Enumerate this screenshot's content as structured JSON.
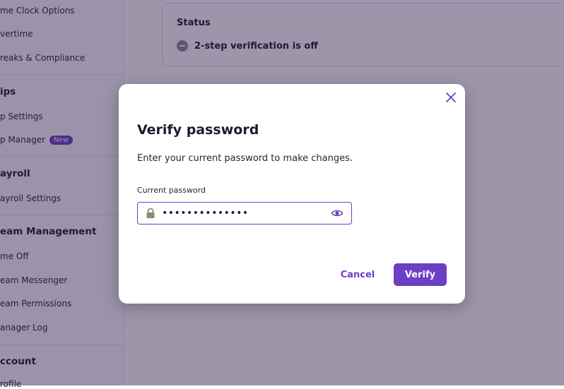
{
  "sidebar": {
    "items": [
      {
        "label": "me Clock Options",
        "kind": "item"
      },
      {
        "label": "vertime",
        "kind": "item"
      },
      {
        "label": "reaks & Compliance",
        "kind": "item"
      },
      {
        "label": "ips",
        "kind": "section"
      },
      {
        "label": "p Settings",
        "kind": "item"
      },
      {
        "label": "p Manager",
        "kind": "item",
        "badge": "New"
      },
      {
        "label": "ayroll",
        "kind": "section"
      },
      {
        "label": "ayroll Settings",
        "kind": "item"
      },
      {
        "label": "eam Management",
        "kind": "section"
      },
      {
        "label": "me Off",
        "kind": "item"
      },
      {
        "label": "eam Messenger",
        "kind": "item"
      },
      {
        "label": "eam Permissions",
        "kind": "item"
      },
      {
        "label": "anager Log",
        "kind": "item"
      },
      {
        "label": "ccount",
        "kind": "section"
      },
      {
        "label": "rofile",
        "kind": "item"
      }
    ]
  },
  "status_card": {
    "title": "Status",
    "status_text": "2-step verification is off",
    "status_icon": "minus-circle-icon"
  },
  "modal": {
    "title": "Verify password",
    "description": "Enter your current password to make changes.",
    "field_label": "Current password",
    "password_value": "••••••••••••••",
    "cancel_label": "Cancel",
    "verify_label": "Verify",
    "icons": {
      "close": "close-icon",
      "lock": "lock-icon",
      "eye": "eye-icon"
    }
  },
  "colors": {
    "accent": "#6d3fc4",
    "overlay": "rgba(38,22,68,0.45)",
    "status_icon": "#8d8a96",
    "lock_icon": "#8c8a77"
  }
}
